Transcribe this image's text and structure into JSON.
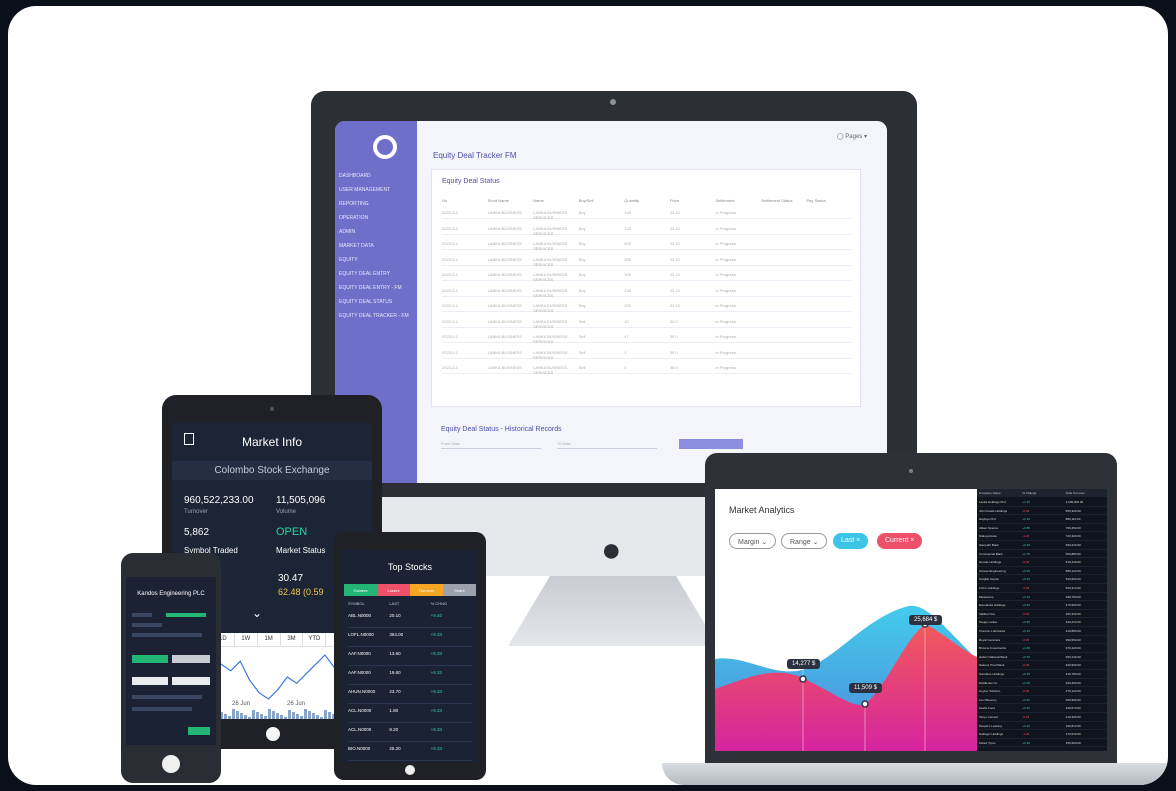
{
  "monitor": {
    "app_title": "Equity Deal Tracker FM",
    "user": "Pages",
    "card_title": "Equity Deal Status",
    "columns": [
      "No",
      "Short Name",
      "Name",
      "Buy/Sell",
      "Quantity",
      "Price",
      "Settlement",
      "Settlement Status",
      "Pay Status"
    ],
    "rows": [
      [
        "2023-0-1",
        "LANKA BUSINESS",
        "LANKA BUSINESS SERVICES",
        "Buy",
        "140",
        "22.10",
        "In Progress",
        "",
        ""
      ],
      [
        "2023-0-1",
        "LANKA BUSINESS",
        "LANKA BUSINESS SERVICES",
        "Buy",
        "120",
        "22.10",
        "In Progress",
        "",
        ""
      ],
      [
        "2023-0-1",
        "LANKA BUSINESS",
        "LANKA BUSINESS SERVICES",
        "Buy",
        "400",
        "22.10",
        "In Progress",
        "",
        ""
      ],
      [
        "2023-0-1",
        "LANKA BUSINESS",
        "LANKA BUSINESS SERVICES",
        "Buy",
        "250",
        "22.10",
        "In Progress",
        "",
        ""
      ],
      [
        "2023-0-1",
        "LANKA BUSINESS",
        "LANKA BUSINESS SERVICES",
        "Buy",
        "100",
        "22.10",
        "In Progress",
        "",
        ""
      ],
      [
        "2023-0-1",
        "LANKA BUSINESS",
        "LANKA BUSINESS SERVICES",
        "Buy",
        "130",
        "22.10",
        "In Progress",
        "",
        ""
      ],
      [
        "2023-0-1",
        "LANKA BUSINESS",
        "LANKA BUSINESS SERVICES",
        "Buy",
        "200",
        "22.10",
        "In Progress",
        "",
        ""
      ],
      [
        "2023-0-1",
        "LANKA BUSINESS",
        "LANKA BUSINESS SERVICES",
        "Sell",
        "10",
        "30.0",
        "In Progress",
        "",
        ""
      ],
      [
        "2023-0-1",
        "LANKA BUSINESS",
        "LANKA BUSINESS SERVICES",
        "Sell",
        "47",
        "30.0",
        "In Progress",
        "",
        ""
      ],
      [
        "2023-0-1",
        "LANKA BUSINESS",
        "LANKA BUSINESS SERVICES",
        "Sell",
        "1",
        "30.0",
        "In Progress",
        "",
        ""
      ],
      [
        "2023-0-1",
        "LANKA BUSINESS",
        "LANKA BUSINESS SERVICES",
        "Sell",
        "4",
        "30.0",
        "In Progress",
        "",
        ""
      ]
    ],
    "sidebar_items": [
      "DASHBOARD",
      "USER MANAGEMENT",
      "REPORTING",
      "OPERATION",
      "ADMIN",
      "MARKET DATA",
      "EQUITY",
      "EQUITY DEAL ENTRY",
      "EQUITY DEAL ENTRY - FM",
      "EQUITY DEAL STATUS",
      "EQUITY DEAL TRACKER - FM"
    ],
    "historical_title": "Equity Deal Status - Historical Records",
    "from_date": "From Date",
    "to_date": "To Date"
  },
  "tablet": {
    "title": "Market Info",
    "exchange": "Colombo Stock Exchange",
    "turnover_value": "960,522,233.00",
    "turnover_label": "Turnover",
    "volume_value": "11,505,096",
    "volume_label": "Volume",
    "trades_value": "5,862",
    "trades_label": "Symbol Traded",
    "status_value": "OPEN",
    "status_label": "Market Status",
    "price": "30.47",
    "change": "62.48 (0.59",
    "ranges": [
      "1D",
      "1W",
      "1M",
      "3M",
      "YTD",
      "1Y",
      "ALL"
    ],
    "chart_labels": [
      "26 Jun",
      "26 Jun",
      "26 Jun"
    ],
    "chart_series": [
      62,
      58,
      54,
      60,
      48,
      40,
      36,
      42,
      50,
      46,
      52,
      58,
      64,
      56,
      60,
      54,
      62,
      58
    ]
  },
  "phone": {
    "title": "Kandos Engineering PLC"
  },
  "stocks": {
    "title": "Top Stocks",
    "tabs": [
      "Gainers",
      "Losers",
      "Turnover",
      "Share"
    ],
    "tab_colors": [
      "#22b573",
      "#ef5069",
      "#f5a623",
      "#9aa2ae"
    ],
    "columns": [
      "SYMBOL",
      "LAST",
      "% CHNG"
    ],
    "rows": [
      [
        "ABL.N0000",
        "20.10",
        "+9.40"
      ],
      [
        "LOFL.N0000",
        "364.00",
        "+8.33"
      ],
      [
        "AAF.N0000",
        "13.60",
        "+8.33"
      ],
      [
        "AAF.N0000",
        "19.60",
        "+8.33"
      ],
      [
        "AHUN.N0000",
        "23.70",
        "+8.33"
      ],
      [
        "ACL.N0000",
        "1.80",
        "+8.33"
      ],
      [
        "ACL.N0000",
        "8.20",
        "+8.33"
      ],
      [
        "BIO.N0000",
        "25.20",
        "+8.33"
      ]
    ]
  },
  "laptop": {
    "title": "Market Analytics",
    "pills": [
      "Margin",
      "Range",
      "Last",
      "Current"
    ],
    "callouts": [
      "14,277 $",
      "11,509 $",
      "25,684 $"
    ],
    "list_head": [
      "Company Name",
      "% Change",
      "Total Turnover"
    ],
    "list_rows": [
      [
        "Lanka Holdings PLC",
        "+1.36",
        "1,035,000.00"
      ],
      [
        "John Keells Holdings",
        "-0.45",
        "950,320.00"
      ],
      [
        "Hayleys PLC",
        "+2.10",
        "880,110.00"
      ],
      [
        "Aitken Spence",
        "+0.85",
        "760,450.00"
      ],
      [
        "Dialog Axiata",
        "-1.20",
        "720,300.00"
      ],
      [
        "Sampath Bank",
        "+0.40",
        "690,220.00"
      ],
      [
        "Commercial Bank",
        "+1.75",
        "650,880.00"
      ],
      [
        "Hemas Holdings",
        "-0.30",
        "610,440.00"
      ],
      [
        "Access Engineering",
        "+0.95",
        "580,120.00"
      ],
      [
        "Cargills Ceylon",
        "+0.25",
        "540,600.00"
      ],
      [
        "LOLC Holdings",
        "-2.05",
        "520,310.00"
      ],
      [
        "Melstacorp",
        "+1.10",
        "490,700.00"
      ],
      [
        "Expolanka Holdings",
        "+3.40",
        "470,900.00"
      ],
      [
        "Vallibel One",
        "-0.65",
        "450,330.00"
      ],
      [
        "Teejay Lanka",
        "+0.55",
        "430,210.00"
      ],
      [
        "Chevron Lubricants",
        "+0.15",
        "410,880.00"
      ],
      [
        "Royal Ceramics",
        "-0.90",
        "390,560.00"
      ],
      [
        "Browns Investments",
        "+1.65",
        "370,420.00"
      ],
      [
        "Hatton National Bank",
        "+0.70",
        "350,140.00"
      ],
      [
        "Nations Trust Bank",
        "-0.20",
        "330,900.00"
      ],
      [
        "Sunshine Holdings",
        "+0.35",
        "310,780.00"
      ],
      [
        "Distilleries Co",
        "+1.05",
        "290,450.00"
      ],
      [
        "Ceylon Tobacco",
        "-0.50",
        "270,120.00"
      ],
      [
        "Lion Brewery",
        "+0.60",
        "250,990.00"
      ],
      [
        "Keells Food",
        "+0.20",
        "230,670.00"
      ],
      [
        "Tokyo Cement",
        "-0.15",
        "210,330.00"
      ],
      [
        "People's Leasing",
        "+0.45",
        "190,810.00"
      ],
      [
        "Softlogic Holdings",
        "-1.40",
        "170,540.00"
      ],
      [
        "Kelani Tyres",
        "+2.30",
        "150,260.00"
      ]
    ]
  }
}
